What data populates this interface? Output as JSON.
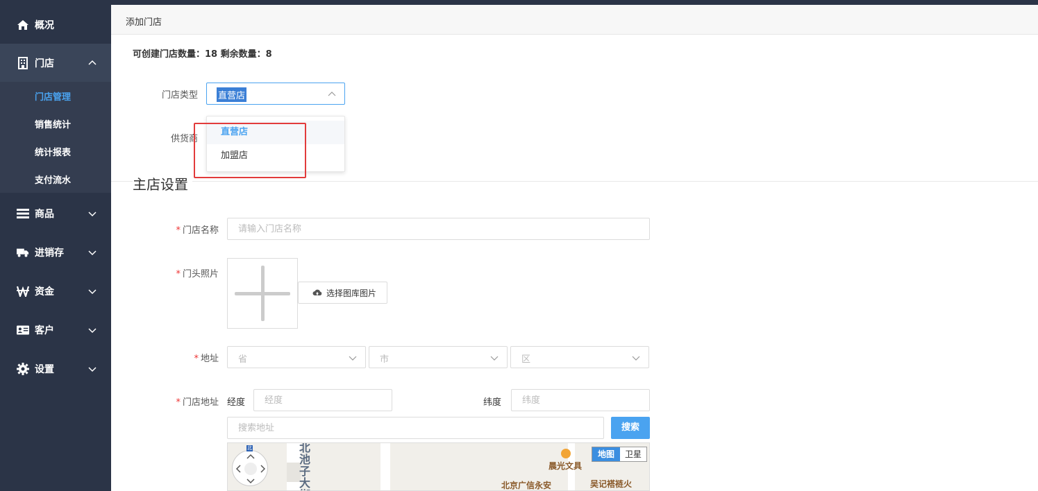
{
  "sidebar": {
    "items": [
      {
        "label": "概况",
        "icon": "home-icon"
      },
      {
        "label": "门店",
        "icon": "building-icon"
      },
      {
        "label": "商品",
        "icon": "list-icon"
      },
      {
        "label": "进销存",
        "icon": "truck-icon"
      },
      {
        "label": "资金",
        "icon": "currency-icon"
      },
      {
        "label": "客户",
        "icon": "id-card-icon"
      },
      {
        "label": "设置",
        "icon": "gear-icon"
      }
    ],
    "store_sub": [
      "门店管理",
      "销售统计",
      "统计报表",
      "支付流水"
    ]
  },
  "breadcrumb": "添加门店",
  "quota": "可创建门店数量：18 剩余数量：8",
  "store_type": {
    "label": "门店类型",
    "value": "直营店",
    "options": [
      "直营店",
      "加盟店"
    ]
  },
  "supplier_label": "供货商",
  "section_title": "主店设置",
  "store_name": {
    "label": "门店名称",
    "placeholder": "请输入门店名称"
  },
  "door_photo": {
    "label": "门头照片",
    "button": "选择图库图片"
  },
  "address": {
    "label": "地址",
    "province": "省",
    "city": "市",
    "district": "区"
  },
  "store_address": {
    "label": "门店地址",
    "lng_label": "经度",
    "lng_placeholder": "经度",
    "lat_label": "纬度",
    "lat_placeholder": "纬度",
    "search_placeholder": "搜索地址",
    "search_button": "搜索"
  },
  "map": {
    "type_map": "地图",
    "type_satellite": "卫星",
    "street": "北池子大街",
    "poi1": "晨光文具",
    "poi2": "北京广信永安",
    "poi3": "吴记褡裢火",
    "badge": "北"
  },
  "colors": {
    "sidebar_bg": "#2b3447",
    "accent": "#4aa3f0",
    "highlight": "#e23b3b"
  }
}
